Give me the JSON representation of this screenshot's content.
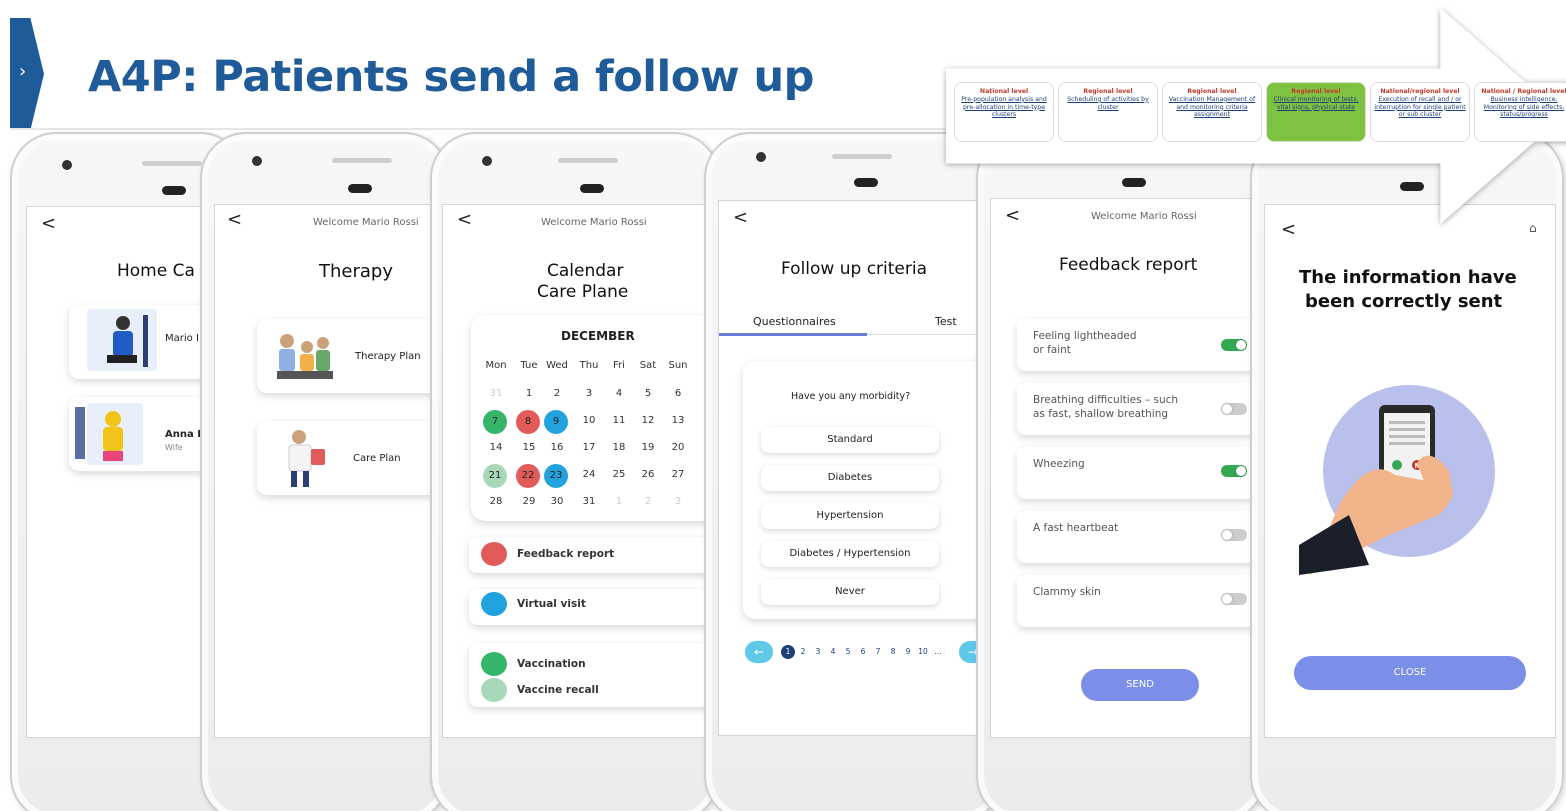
{
  "slide": {
    "title": "A4P: Patients send a follow up"
  },
  "process": [
    {
      "level": "National level",
      "desc": "Pre-population analysis and pre-allocation in time-type clusters"
    },
    {
      "level": "Regional level",
      "desc": "Scheduling of activities by cluster"
    },
    {
      "level": "Regional level",
      "desc": "Vaccination Management of and monitoring criteria assignment"
    },
    {
      "level": "Regional level",
      "desc": "Clinical monitoring of tests, vital signs, physical state",
      "active": true
    },
    {
      "level": "National/regional level",
      "desc": "Execution of recall and / or interruption for single patient or sub cluster"
    },
    {
      "level": "National / Regional level",
      "desc": "Business intelligence. Monitoring of side effects, status/progress"
    }
  ],
  "colors": {
    "brand": "#1f5a99",
    "active_step": "#7fc241",
    "red": "#e15b5b",
    "blue": "#22a3e0",
    "green": "#34b56a",
    "light_green": "#a9d8b8",
    "send": "#7b8ee8",
    "toggle_on": "#34a853"
  },
  "screen1": {
    "back": "<",
    "title": "Home Ca",
    "patients": [
      {
        "name": "Mario I",
        "sub": ""
      },
      {
        "name": "Anna B",
        "sub": "Wife"
      }
    ]
  },
  "screen2": {
    "back": "<",
    "welcome": "Welcome Mario Rossi",
    "title": "Therapy",
    "items": [
      "Therapy Plan",
      "Care Plan"
    ]
  },
  "screen3": {
    "back": "<",
    "welcome": "Welcome Mario Rossi",
    "title_line1": "Calendar",
    "title_line2": "Care Plane",
    "month": "DECEMBER",
    "weekdays": [
      "Mon",
      "Tue",
      "Wed",
      "Thu",
      "Fri",
      "Sat",
      "Sun"
    ],
    "weeks": [
      [
        "31",
        "1",
        "2",
        "3",
        "4",
        "5",
        "6"
      ],
      [
        "7",
        "8",
        "9",
        "10",
        "11",
        "12",
        "13"
      ],
      [
        "14",
        "15",
        "16",
        "17",
        "18",
        "19",
        "20"
      ],
      [
        "21",
        "22",
        "23",
        "24",
        "25",
        "26",
        "27"
      ],
      [
        "28",
        "29",
        "30",
        "31",
        "1",
        "2",
        "3"
      ]
    ],
    "legend": [
      {
        "label": "Feedback report",
        "color": "red"
      },
      {
        "label": "Virtual visit",
        "color": "blue"
      },
      {
        "label": "Vaccination",
        "color": "green"
      },
      {
        "label": "Vaccine recall",
        "color": "light_green"
      }
    ]
  },
  "screen4": {
    "back": "<",
    "title": "Follow up criteria",
    "tabs": [
      "Questionnaires",
      "Test"
    ],
    "question": "Have you any morbidity?",
    "options": [
      "Standard",
      "Diabetes",
      "Hypertension",
      "Diabetes / Hypertension",
      "Never"
    ],
    "pages": [
      "1",
      "2",
      "3",
      "4",
      "5",
      "6",
      "7",
      "8",
      "9",
      "10",
      "..."
    ]
  },
  "screen5": {
    "back": "<",
    "welcome": "Welcome Mario Rossi",
    "title": "Feedback report",
    "items": [
      {
        "l1": "Feeling lightheaded",
        "l2": "or faint",
        "on": true
      },
      {
        "l1": "Breathing difficulties – such",
        "l2": "as fast, shallow breathing",
        "on": false
      },
      {
        "l1": "Wheezing",
        "l2": "",
        "on": true
      },
      {
        "l1": "A fast heartbeat",
        "l2": "",
        "on": false
      },
      {
        "l1": "Clammy skin",
        "l2": "",
        "on": false
      }
    ],
    "send": "SEND"
  },
  "screen6": {
    "back": "<",
    "title_line1": "The information have",
    "title_line2": "been correctly sent",
    "close": "CLOSE"
  }
}
